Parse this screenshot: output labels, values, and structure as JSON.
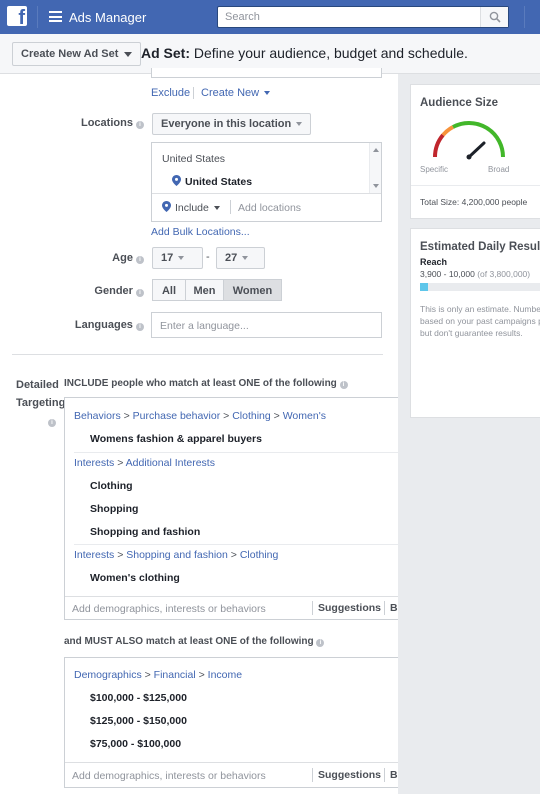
{
  "topbar": {
    "logo_letter": "f",
    "app_name": "Ads Manager",
    "search_placeholder": "Search"
  },
  "subbar": {
    "create_button": "Create New Ad Set",
    "title_bold": "Ad Set:",
    "title_rest": " Define your audience, budget and schedule."
  },
  "audience": {
    "exclude_link": "Exclude",
    "create_new_link": "Create New",
    "locations_label": "Locations",
    "locations_dropdown": "Everyone in this location",
    "location_country_header": "United States",
    "location_selected": "United States",
    "include_dropdown": "Include",
    "add_locations_placeholder": "Add locations",
    "add_bulk_link": "Add Bulk Locations...",
    "age_label": "Age",
    "age_min": "17",
    "age_dash": "-",
    "age_max": "27",
    "gender_label": "Gender",
    "gender_options": [
      "All",
      "Men",
      "Women"
    ],
    "gender_selected": "Women",
    "languages_label": "Languages",
    "languages_placeholder": "Enter a language..."
  },
  "detailed": {
    "label_line1": "Detailed",
    "label_line2": "Targeting",
    "include_heading": "INCLUDE people who match at least ONE of the following",
    "include_groups": [
      {
        "crumbs": [
          "Behaviors",
          "Purchase behavior",
          "Clothing",
          "Women's"
        ],
        "items": [
          "Womens fashion & apparel buyers"
        ]
      },
      {
        "crumbs": [
          "Interests",
          "Additional Interests"
        ],
        "items": [
          "Clothing",
          "Shopping",
          "Shopping and fashion"
        ]
      },
      {
        "crumbs": [
          "Interests",
          "Shopping and fashion",
          "Clothing"
        ],
        "items": [
          "Women's clothing"
        ]
      }
    ],
    "add_placeholder": "Add demographics, interests or behaviors",
    "suggestions": "Suggestions",
    "browse": "Browse",
    "must_heading": "and MUST ALSO match at least ONE of the following",
    "close_glyph": "×",
    "must_group": {
      "crumbs": [
        "Demographics",
        "Financial",
        "Income"
      ],
      "items": [
        "$100,000 - $125,000",
        "$125,000 - $150,000",
        "$75,000 - $100,000"
      ]
    }
  },
  "audience_size": {
    "title": "Audience Size",
    "specific": "Specific",
    "broad": "Broad",
    "total": "Total Size: 4,200,000 people"
  },
  "daily_results": {
    "title": "Estimated Daily Results",
    "reach_label": "Reach",
    "reach_range": "3,900 - 10,000",
    "reach_total": " (of 3,800,000)",
    "reach_fill_fraction": 0.06,
    "note": "This is only an estimate. Numbers shown are based on your past campaigns performance, but don't guarantee results."
  },
  "colors": {
    "brand": "#4267b2",
    "gauge_red": "#c0262d",
    "gauge_orange": "#f7923a",
    "gauge_green": "#42b72a",
    "reach_bar": "#5ec6ea"
  }
}
